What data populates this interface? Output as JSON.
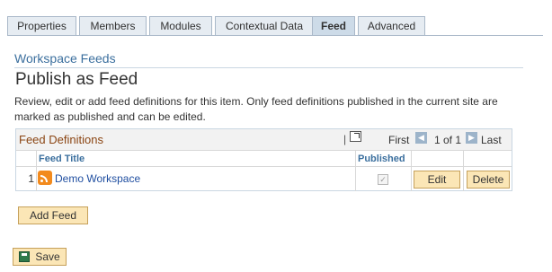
{
  "tabs": [
    {
      "label": "Properties"
    },
    {
      "label": "Members"
    },
    {
      "label": "Modules"
    },
    {
      "label": "Contextual Data"
    },
    {
      "label": "Feed",
      "active": true
    },
    {
      "label": "Advanced"
    }
  ],
  "section_title": "Workspace Feeds",
  "page_title": "Publish as Feed",
  "description": "Review, edit or add feed definitions for this item. Only feed definitions published in the current site are marked as published and can be edited.",
  "grid": {
    "title": "Feed Definitions",
    "separator": "|",
    "first_label": "First",
    "count_label": "1 of 1",
    "last_label": "Last",
    "columns": {
      "feed_title": "Feed Title",
      "published": "Published"
    },
    "rows": [
      {
        "num": "1",
        "title": "Demo Workspace",
        "published": true,
        "edit_label": "Edit",
        "delete_label": "Delete"
      }
    ]
  },
  "add_feed_label": "Add Feed",
  "save_label": "Save",
  "icons": {
    "zoom": "zoom-grid-icon",
    "rss": "rss-feed-icon",
    "save": "save-icon",
    "prev": "arrow-left-icon",
    "next": "arrow-right-icon"
  },
  "colors": {
    "tab_bg": "#e6ecf2",
    "tab_active": "#cddbe8",
    "button_bg": "#fbe6b6",
    "grid_title": "#8b4513",
    "link": "#1f4ea0"
  }
}
